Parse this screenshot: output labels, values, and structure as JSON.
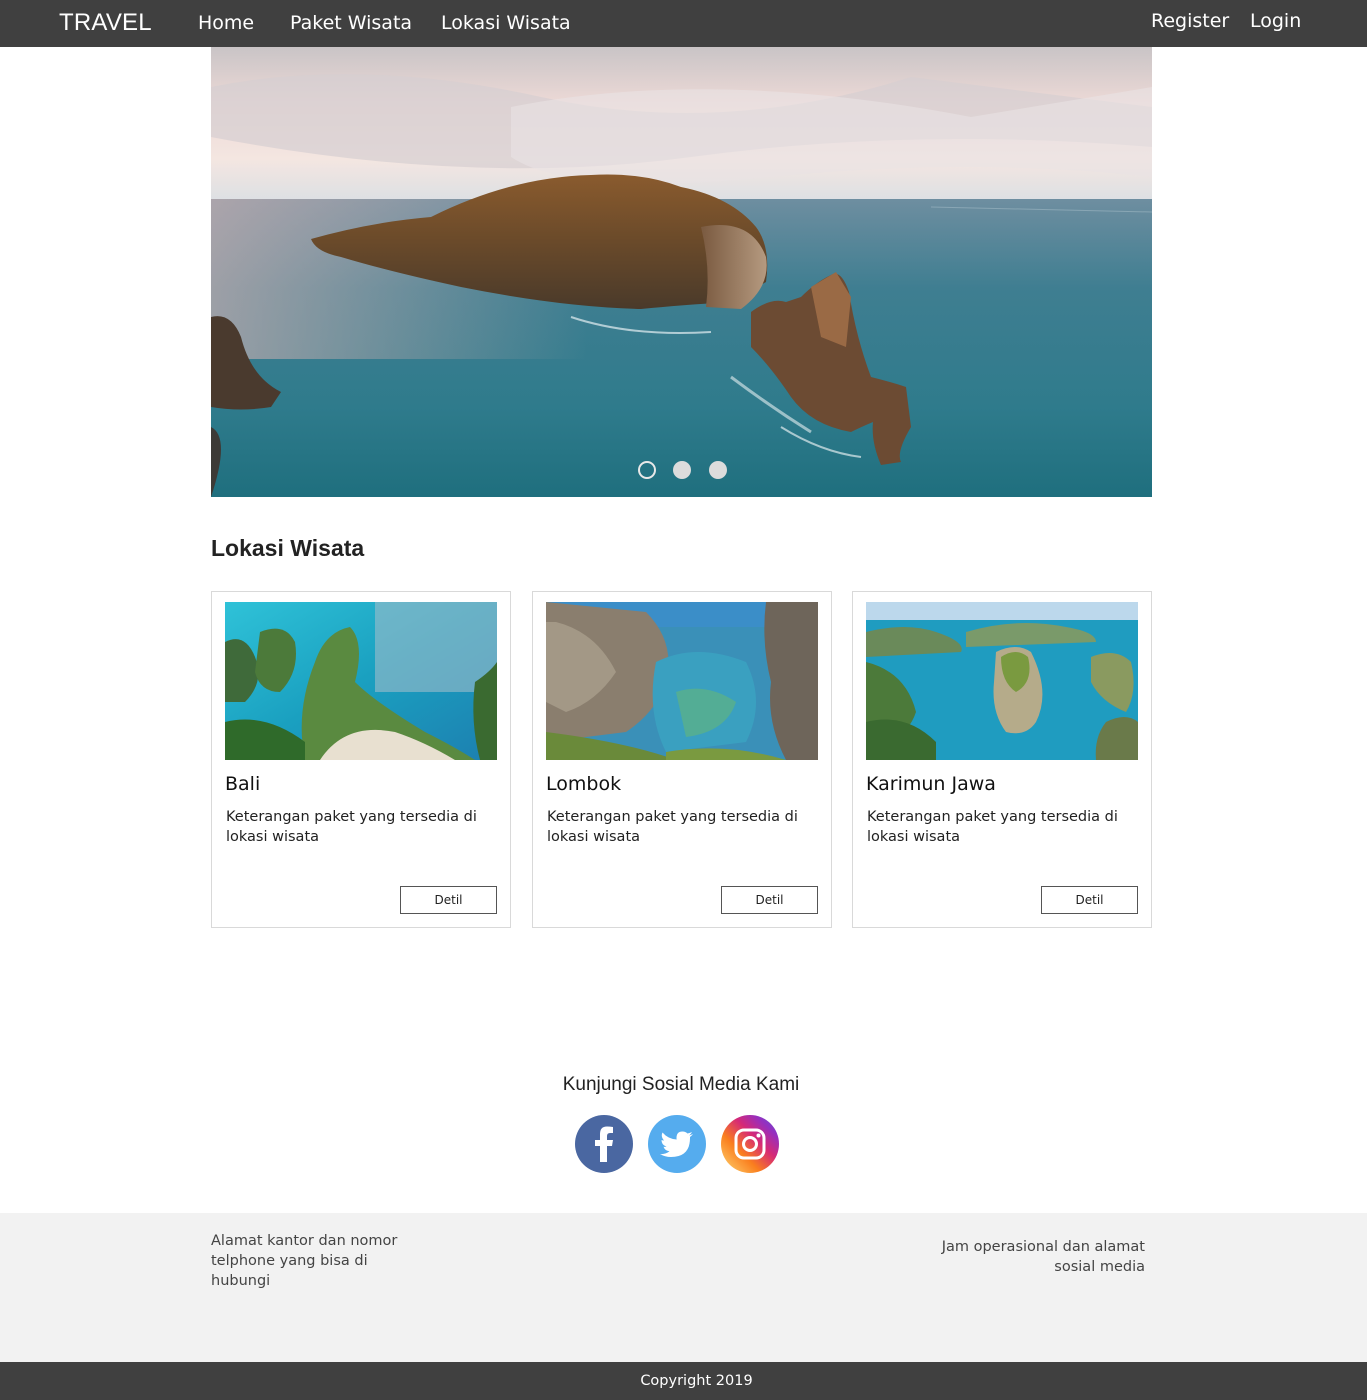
{
  "navbar": {
    "brand": "TRAVEL",
    "links": [
      "Home",
      "Paket Wisata",
      "Lokasi Wisata"
    ],
    "register": "Register",
    "login": "Login"
  },
  "carousel": {
    "slide_count": 3,
    "active_index": 0,
    "image": "sea-cliff-island-photo"
  },
  "section": {
    "title": "Lokasi Wisata"
  },
  "cards": [
    {
      "title": "Bali",
      "description": "Keterangan paket yang tersedia di lokasi wisata",
      "button": "Detil",
      "image": "bali-beach-cliff-photo"
    },
    {
      "title": "Lombok",
      "description": "Keterangan paket yang tersedia di lokasi wisata",
      "button": "Detil",
      "image": "lombok-rock-pool-photo"
    },
    {
      "title": "Karimun Jawa",
      "description": "Keterangan paket yang tersedia di lokasi wisata",
      "button": "Detil",
      "image": "karimun-jawa-island-photo"
    }
  ],
  "social": {
    "title": "Kunjungi Sosial Media Kami",
    "icons": [
      "facebook-icon",
      "twitter-icon",
      "instagram-icon"
    ],
    "colors": {
      "facebook": "#4a67a1",
      "twitter": "#55acee",
      "instagram": "#c13584"
    }
  },
  "info": {
    "left": "Alamat kantor dan nomor telphone yang bisa di hubungi",
    "right": "Jam operasional dan alamat sosial media"
  },
  "footer": {
    "copyright": "Copyright 2019"
  },
  "colors": {
    "navbar_bg": "#404040",
    "info_bg": "#f2f2f2"
  }
}
